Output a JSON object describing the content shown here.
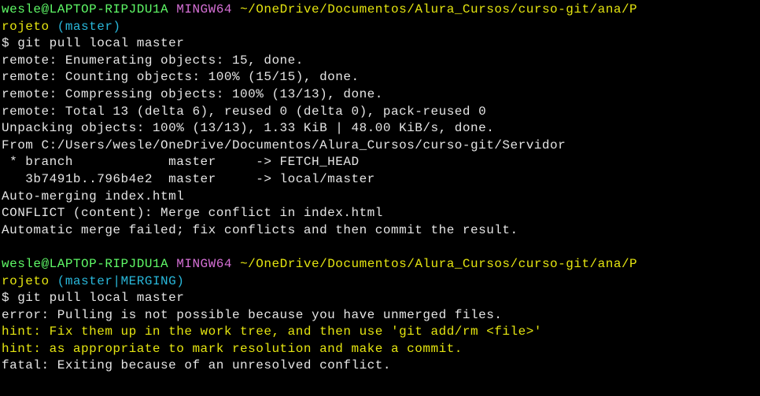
{
  "prompt1": {
    "user_host": "wesle@LAPTOP-RIPJDU1A",
    "shell": "MINGW64",
    "path_a": "~/OneDrive/Documentos/Alura_Cursos/curso-git/ana/P",
    "path_b": "rojeto",
    "branch": "(master)"
  },
  "cmd1": "$ git pull local master",
  "out1": {
    "l1": "remote: Enumerating objects: 15, done.",
    "l2": "remote: Counting objects: 100% (15/15), done.",
    "l3": "remote: Compressing objects: 100% (13/13), done.",
    "l4": "remote: Total 13 (delta 6), reused 0 (delta 0), pack-reused 0",
    "l5": "Unpacking objects: 100% (13/13), 1.33 KiB | 48.00 KiB/s, done.",
    "l6": "From C:/Users/wesle/OneDrive/Documentos/Alura_Cursos/curso-git/Servidor",
    "l7": " * branch            master     -> FETCH_HEAD",
    "l8": "   3b7491b..796b4e2  master     -> local/master",
    "l9": "Auto-merging index.html",
    "l10": "CONFLICT (content): Merge conflict in index.html",
    "l11": "Automatic merge failed; fix conflicts and then commit the result."
  },
  "prompt2": {
    "user_host": "wesle@LAPTOP-RIPJDU1A",
    "shell": "MINGW64",
    "path_a": "~/OneDrive/Documentos/Alura_Cursos/curso-git/ana/P",
    "path_b": "rojeto",
    "branch": "(master|MERGING)"
  },
  "cmd2": "$ git pull local master",
  "out2": {
    "l1": "error: Pulling is not possible because you have unmerged files.",
    "l2": "hint: Fix them up in the work tree, and then use 'git add/rm <file>'",
    "l3": "hint: as appropriate to mark resolution and make a commit.",
    "l4": "fatal: Exiting because of an unresolved conflict."
  }
}
